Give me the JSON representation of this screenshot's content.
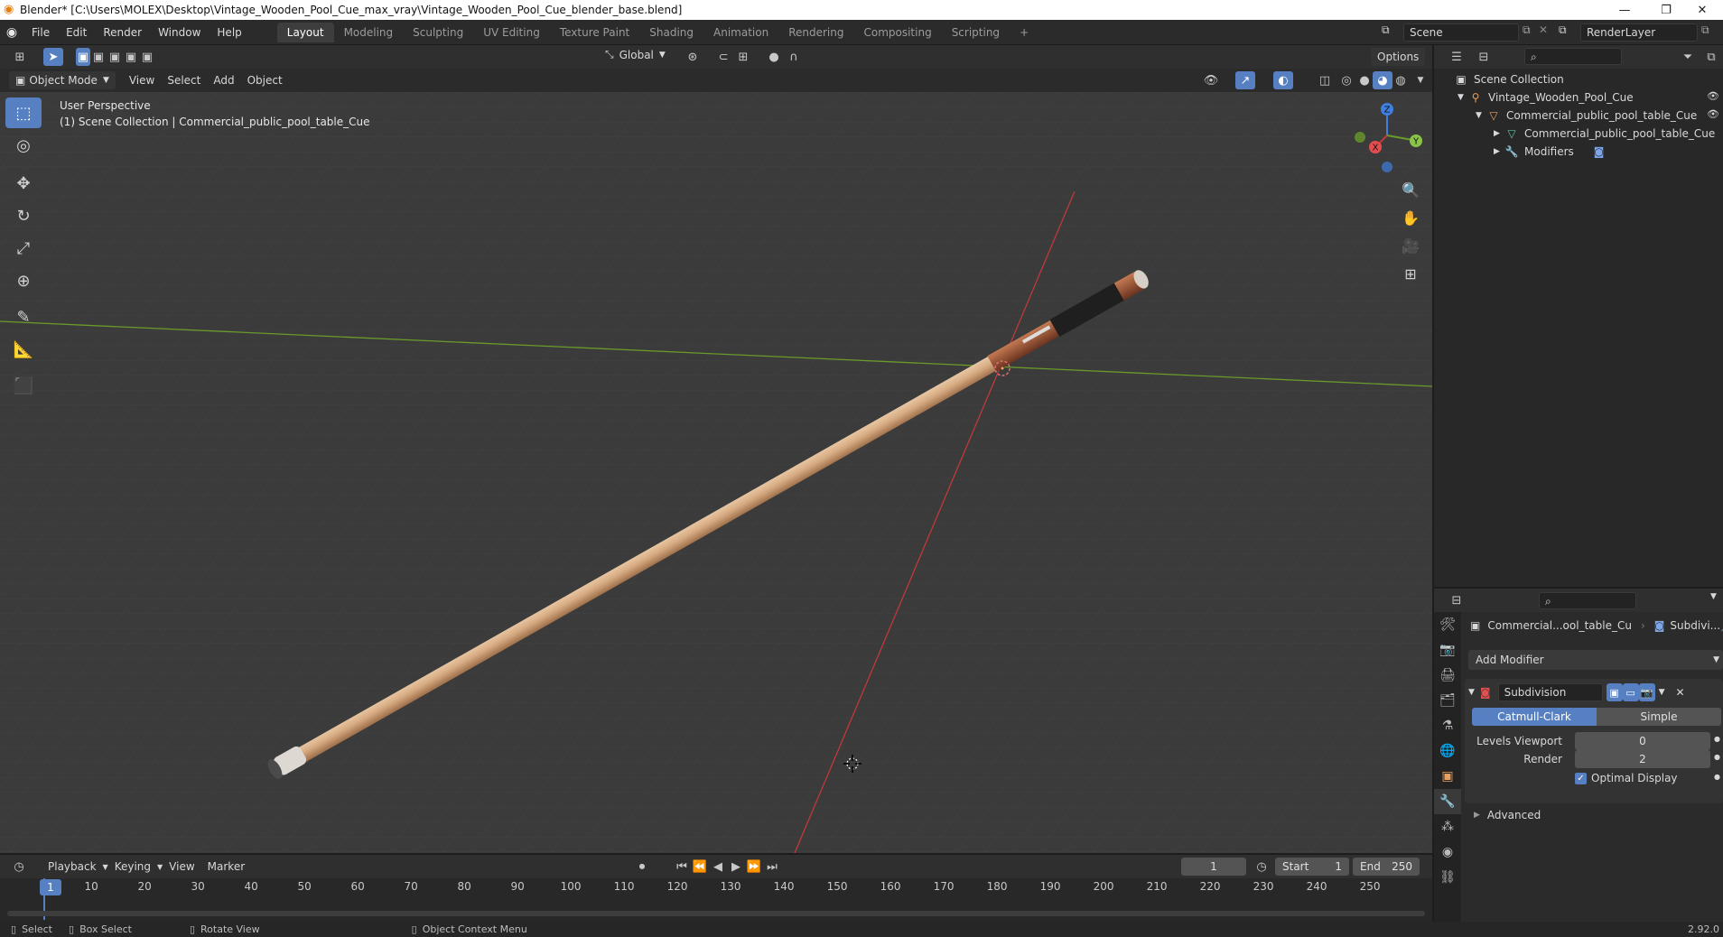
{
  "window": {
    "title": "Blender* [C:\\Users\\MOLEX\\Desktop\\Vintage_Wooden_Pool_Cue_max_vray\\Vintage_Wooden_Pool_Cue_blender_base.blend]",
    "minimize": "—",
    "maximize": "❐",
    "close": "✕"
  },
  "menubar": {
    "items": [
      "File",
      "Edit",
      "Render",
      "Window",
      "Help"
    ],
    "workspaces": [
      "Layout",
      "Modeling",
      "Sculpting",
      "UV Editing",
      "Texture Paint",
      "Shading",
      "Animation",
      "Rendering",
      "Compositing",
      "Scripting"
    ],
    "add_tab": "+",
    "scene": "Scene",
    "render_layer": "RenderLayer"
  },
  "viewport_header": {
    "transform_orientation": "Global",
    "options": "Options",
    "mode": "Object Mode",
    "menus": [
      "View",
      "Select",
      "Add",
      "Object"
    ]
  },
  "viewport": {
    "perspective": "User Perspective",
    "collection_info": "(1) Scene Collection | Commercial_public_pool_table_Cue",
    "gizmo": {
      "x": "X",
      "y": "Y",
      "z": "Z"
    }
  },
  "outliner": {
    "root": "Scene Collection",
    "rows": [
      {
        "label": "Vintage_Wooden_Pool_Cue",
        "icon": "armature-icon"
      },
      {
        "label": "Commercial_public_pool_table_Cue",
        "icon": "object-icon"
      },
      {
        "label": "Commercial_public_pool_table_Cue",
        "icon": "mesh-icon"
      },
      {
        "label": "Modifiers",
        "icon": "wrench-icon"
      }
    ]
  },
  "properties": {
    "object_name": "Commercial...ool_table_Cu",
    "modifier_short": "Subdivi...",
    "add_modifier": "Add Modifier",
    "modifier": {
      "name": "Subdivision",
      "mode_catmull": "Catmull-Clark",
      "mode_simple": "Simple",
      "levels_viewport_label": "Levels Viewport",
      "levels_viewport": "0",
      "render_label": "Render",
      "render": "2",
      "optimal_display": "Optimal Display",
      "advanced": "Advanced"
    }
  },
  "timeline": {
    "menus": [
      "Playback",
      "Keying",
      "View",
      "Marker"
    ],
    "current_frame": "1",
    "start_label": "Start",
    "start": "1",
    "end_label": "End",
    "end": "250",
    "ticks": [
      "10",
      "20",
      "30",
      "40",
      "50",
      "60",
      "70",
      "80",
      "90",
      "100",
      "110",
      "120",
      "130",
      "140",
      "150",
      "160",
      "170",
      "180",
      "190",
      "200",
      "210",
      "220",
      "230",
      "240",
      "250"
    ],
    "playhead": "1"
  },
  "statusbar": {
    "select": "Select",
    "box_select": "Box Select",
    "rotate_view": "Rotate View",
    "context_menu": "Object Context Menu",
    "version": "2.92.0"
  },
  "colors": {
    "accent": "#5680c2",
    "viewport_bg": "#3b3b3b",
    "x_axis": "#c0393b",
    "y_axis": "#6a9a2a",
    "z_axis": "#3f7fe0"
  }
}
